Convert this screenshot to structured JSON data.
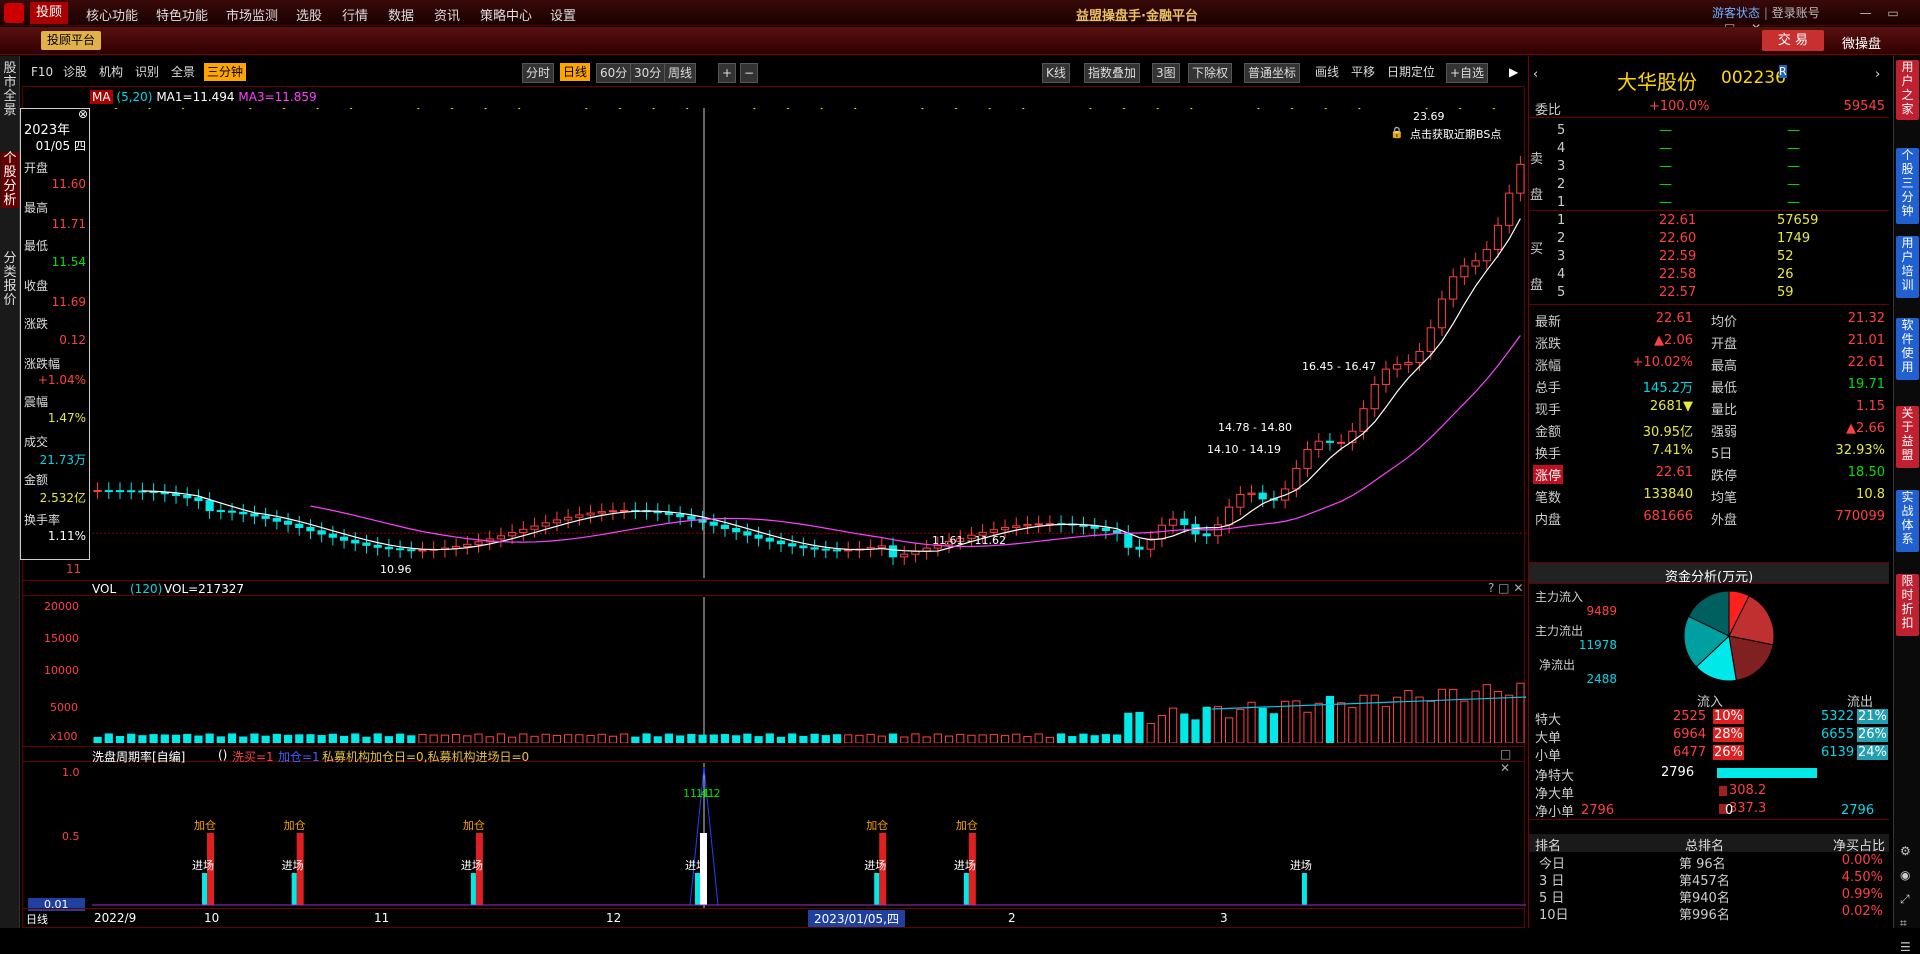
{
  "menu": {
    "items": [
      "投顾",
      "核心功能",
      "特色功能",
      "市场监测",
      "选股",
      "行情",
      "数据",
      "资讯",
      "策略中心",
      "设置"
    ]
  },
  "app": {
    "title": "益盟操盘手·金融平台",
    "guest_status": "游客状态",
    "login": "登录账号"
  },
  "subbar": {
    "platform": "投顾平台",
    "trade": "交 易",
    "micro": "微操盘"
  },
  "left_tabs": [
    "股市全景",
    "个股分析",
    "分类报价"
  ],
  "toolbar": {
    "left": [
      "F10",
      "诊股",
      "机构",
      "识别",
      "全景",
      "三分钟"
    ],
    "period": [
      "分时",
      "日线",
      "60分",
      "30分",
      "周线"
    ],
    "right": [
      "K线",
      "指数叠加",
      "3图",
      "下除权",
      "普通坐标",
      "画线",
      "平移",
      "日期定位",
      "+自选"
    ]
  },
  "ma": {
    "label": "MA",
    "params": "(5,20)",
    "ma1": "MA1=11.494",
    "ma3": "MA3=11.859"
  },
  "info": {
    "year": "2023年",
    "date": "01/05 四",
    "open_l": "开盘",
    "open": "11.60",
    "high_l": "最高",
    "high": "11.71",
    "low_l": "最低",
    "low": "11.54",
    "close_l": "收盘",
    "close": "11.69",
    "chg_l": "涨跌",
    "chg": "0.12",
    "pct_l": "涨跌幅",
    "pct": "+1.04%",
    "amp_l": "震幅",
    "amp": "1.47%",
    "vol_l": "成交",
    "vol": "21.73万",
    "amt_l": "金额",
    "amt": "2.532亿",
    "turn_l": "换手率",
    "turn": "1.11%"
  },
  "annot": {
    "peak": "23.69",
    "bs": "点击获取近期BS点",
    "r1": "16.45 - 16.47",
    "r2": "14.78 - 14.80",
    "r3": "14.10 - 14.19",
    "r4": "11.61 - 11.62",
    "low": "10.96",
    "axis11": "11"
  },
  "vol": {
    "label": "VOL",
    "param": "(120)",
    "value": "VOL=217327",
    "ticks": [
      "20000",
      "15000",
      "10000",
      "5000",
      "x100"
    ]
  },
  "wash": {
    "label": "洗盘周期率[自编]",
    "params": "()",
    "xm": "洗买=1",
    "jr": "加仓=1",
    "pm": "私募机构加仓日=0,私募机构进场日=0",
    "ticks": [
      "1.0",
      "0.5",
      "0.01"
    ],
    "tags_add": "加仓",
    "tags_in": "进场",
    "v1": "11.41",
    "v2": "11.2"
  },
  "xaxis": {
    "labels": [
      "2022/9",
      "10",
      "11",
      "12",
      "2023/01/05,四",
      "2",
      "3"
    ],
    "period": "日线"
  },
  "stock": {
    "name": "大华股份",
    "code": "002236",
    "badge": "R"
  },
  "quote": {
    "wb_l": "委比",
    "wb": "+100.0%",
    "wb2": "59545",
    "sell": [
      [
        "5",
        "—",
        "—"
      ],
      [
        "4",
        "—",
        "—"
      ],
      [
        "3",
        "—",
        "—"
      ],
      [
        "2",
        "—",
        "—"
      ],
      [
        "1",
        "—",
        "—"
      ]
    ],
    "buy": [
      [
        "1",
        "22.61",
        "57659"
      ],
      [
        "2",
        "22.60",
        "1749"
      ],
      [
        "3",
        "22.59",
        "52"
      ],
      [
        "4",
        "22.58",
        "26"
      ],
      [
        "5",
        "22.57",
        "59"
      ]
    ],
    "sell_lbl": "卖盘",
    "buy_lbl": "买盘",
    "rows": [
      [
        "最新",
        "22.61",
        "均价",
        "21.32"
      ],
      [
        "涨跌",
        "▲2.06",
        "开盘",
        "21.01"
      ],
      [
        "涨幅",
        "+10.02%",
        "最高",
        "22.61"
      ],
      [
        "总手",
        "145.2万",
        "最低",
        "19.71"
      ],
      [
        "现手",
        "2681▼",
        "量比",
        "1.15"
      ],
      [
        "金额",
        "30.95亿",
        "强弱",
        "▲2.66"
      ],
      [
        "换手",
        "7.41%",
        "5日",
        "32.93%"
      ],
      [
        "涨停",
        "22.61",
        "跌停",
        "18.50"
      ],
      [
        "笔数",
        "133840",
        "均笔",
        "10.8"
      ],
      [
        "内盘",
        "681666",
        "外盘",
        "770099"
      ]
    ]
  },
  "capital": {
    "title": "资金分析(万元)",
    "in_l": "主力流入",
    "in": "9489",
    "out_l": "主力流出",
    "out": "11978",
    "net_l": "净流出",
    "net": "2488",
    "flow_in": "流入",
    "flow_out": "流出",
    "rows": [
      [
        "特大",
        "2525",
        "10%",
        "5322",
        "21%"
      ],
      [
        "大单",
        "6964",
        "28%",
        "6655",
        "26%"
      ],
      [
        "小单",
        "6477",
        "26%",
        "6139",
        "24%"
      ]
    ],
    "net_rows": [
      [
        "净特大",
        "2796"
      ],
      [
        "净大单",
        "308.2"
      ],
      [
        "净小单",
        "337.3"
      ]
    ],
    "scale": [
      "2796",
      "0",
      "2796"
    ]
  },
  "rank": {
    "h": [
      "排名",
      "总排名",
      "净买占比"
    ],
    "rows": [
      [
        "今日",
        "第 96名",
        "0.00%"
      ],
      [
        "3 日",
        "第457名",
        "4.50%"
      ],
      [
        "5 日",
        "第940名",
        "0.99%"
      ],
      [
        "10日",
        "第996名",
        "0.02%"
      ]
    ]
  },
  "right_tabs": [
    "用户之家",
    "个股三分钟",
    "用户培训",
    "软件使用",
    "关于益盟",
    "实战体系",
    "限时折扣"
  ],
  "colors": {
    "up": "#ff4040",
    "down": "#00e8e8",
    "ma": "#ffffff",
    "ma2": "#ff40ff",
    "bg": "#000000"
  }
}
